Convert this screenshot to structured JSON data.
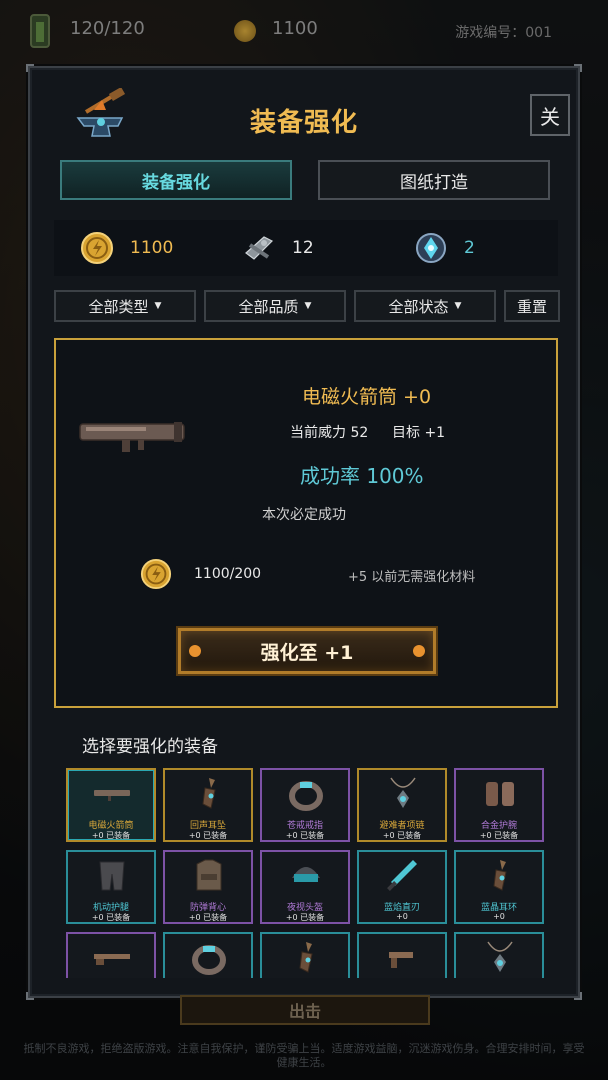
{
  "hud": {
    "energy": "120/120",
    "gold": "1100",
    "game_id": "游戏编号：001"
  },
  "dialog": {
    "title": "装备强化",
    "close_label": "关",
    "tabs": [
      {
        "label": "装备强化",
        "active": true
      },
      {
        "label": "图纸打造",
        "active": false
      }
    ]
  },
  "resources": {
    "gold": "1100",
    "parts": "12",
    "crystal": "2"
  },
  "filters": {
    "type": "全部类型",
    "quality": "全部品质",
    "status": "全部状态",
    "reset": "重置"
  },
  "upgrade": {
    "name": "电磁火箭筒 +0",
    "power": "当前威力 52",
    "target": "目标 +1",
    "success_rate": "成功率 100%",
    "note": "本次必定成功",
    "cost": "1100/200",
    "material_note": "+5 以前无需强化材料",
    "button_label": "强化至 +1"
  },
  "list": {
    "title": "选择要强化的装备",
    "items": [
      {
        "name": "电磁火箭筒",
        "status": "+0  已装备",
        "rarity": "gold",
        "icon": "rocket-launcher-icon"
      },
      {
        "name": "回声耳坠",
        "status": "+0  已装备",
        "rarity": "gold",
        "icon": "earring-icon"
      },
      {
        "name": "苍戒戒指",
        "status": "+0  已装备",
        "rarity": "purple",
        "icon": "ring-icon"
      },
      {
        "name": "避难者项链",
        "status": "+0  已装备",
        "rarity": "gold",
        "icon": "necklace-icon"
      },
      {
        "name": "合金护腕",
        "status": "+0  已装备",
        "rarity": "purple",
        "icon": "bracer-icon"
      },
      {
        "name": "机动护腿",
        "status": "+0  已装备",
        "rarity": "cyan",
        "icon": "leg-armor-icon"
      },
      {
        "name": "防弹背心",
        "status": "+0  已装备",
        "rarity": "purple",
        "icon": "vest-icon"
      },
      {
        "name": "夜视头盔",
        "status": "+0  已装备",
        "rarity": "purple",
        "icon": "helmet-icon"
      },
      {
        "name": "蓝焰直刃",
        "status": "+0",
        "rarity": "cyan",
        "icon": "blade-icon"
      },
      {
        "name": "蓝晶耳环",
        "status": "+0",
        "rarity": "cyan",
        "icon": "earring-icon"
      },
      {
        "name": "",
        "status": "",
        "rarity": "purple",
        "icon": "shotgun-icon"
      },
      {
        "name": "",
        "status": "",
        "rarity": "cyan",
        "icon": "ring-icon"
      },
      {
        "name": "",
        "status": "",
        "rarity": "cyan",
        "icon": "earring-icon"
      },
      {
        "name": "",
        "status": "",
        "rarity": "cyan",
        "icon": "pistol-icon"
      },
      {
        "name": "",
        "status": "",
        "rarity": "cyan",
        "icon": "necklace-icon"
      }
    ]
  },
  "footer": {
    "sortie": "出击",
    "disclaimer": "抵制不良游戏，拒绝盗版游戏。注意自我保护，谨防受骗上当。适度游戏益脑，沉迷游戏伤身。合理安排时间，享受健康生活。"
  },
  "colors": {
    "accent_gold": "#f0bb52",
    "accent_cyan": "#5fc9d6",
    "rarity_gold": "#b08a2a",
    "rarity_purple": "#7d52a6",
    "rarity_cyan": "#2a8e99"
  }
}
